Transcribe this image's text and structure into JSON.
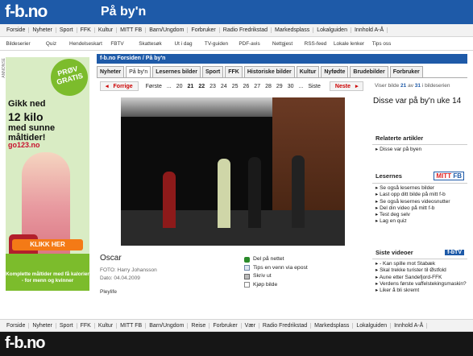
{
  "header": {
    "logo": "f-b.no",
    "page_title": "På by'n"
  },
  "nav_main": [
    "Forside",
    "Nyheter",
    "Sport",
    "FFK",
    "Kultur",
    "MITT FB",
    "Barn/Ungdom",
    "Forbruker",
    "Radio Fredrikstad",
    "Markedsplass",
    "Lokalguiden",
    "Innhold A-Å"
  ],
  "nav_sub": [
    "Bildeserier",
    "Quiz",
    "Hendelseskart",
    "FBTV",
    "Skattesøk",
    "Ut i dag",
    "TV-guiden",
    "PDF-avis",
    "Nettgjest",
    "RSS-feed",
    "Lokale lenker",
    "Tips oss"
  ],
  "ad": {
    "label": "ANNONSE",
    "badge": "PRØV GRATIS",
    "line1": "Gikk ned",
    "line2": "12 kilo",
    "line3": "med sunne måltider!",
    "brand": "go123.no",
    "cta": "KLIKK HER",
    "footer": "Komplette måltider med få kalorier - for menn og kvinner"
  },
  "breadcrumb": "f-b.no Forsiden / På by'n",
  "tabs": [
    "Nyheter",
    "På by'n",
    "Lesernes bilder",
    "Sport",
    "FFK",
    "Historiske bilder",
    "Kultur",
    "Nyfødte",
    "Brudebilder",
    "Forbruker"
  ],
  "pager": {
    "prev": "Forrige",
    "first": "Første",
    "pages": [
      "...",
      "20",
      "21",
      "22",
      "23",
      "24",
      "25",
      "26",
      "27",
      "28",
      "29",
      "30",
      "..."
    ],
    "current": "22",
    "last": "Siste",
    "next": "Neste"
  },
  "viewing": {
    "prefix": "Viser bilde",
    "current": "21",
    "sep": "av",
    "total": "31",
    "suffix": "i bildeserien"
  },
  "photo": {
    "caption": "Oscar",
    "photographer": "FOTO: Harry Johansson",
    "date": "Dato: 04.04.2009",
    "tag": "Pleylife"
  },
  "actions": [
    "Del på nettet",
    "Tips en venn via epost",
    "Skriv ut",
    "Kjøp bilde"
  ],
  "series_title": "Disse var på by'n uke 14",
  "related": {
    "heading": "Relaterte artikler",
    "items": [
      "Disse var på byen"
    ]
  },
  "readers": {
    "heading": "Lesernes",
    "badge_a": "MITT",
    "badge_b": "FB",
    "items": [
      "Se også lesernes bilder",
      "Last opp ditt bilde på mitt f-b",
      "Se også lesernes videosnutter",
      "Del din video på mitt f-b",
      "Test deg selv",
      "Lag en quiz"
    ]
  },
  "videos": {
    "heading": "Siste videoer",
    "badge": "f-bTV",
    "items": [
      "- Kan spille mot Stabæk",
      "Skal trekke turister til Østfold",
      "Aune etter Sandefjord-FFK",
      "Verdens første vaffelstekingsmaskin?",
      "Liker å bli skremt"
    ]
  },
  "nav_footer": [
    "Forside",
    "Nyheter",
    "Sport",
    "FFK",
    "Kultur",
    "MITT FB",
    "Barn/Ungdom",
    "Reise",
    "Forbruker",
    "Vær",
    "Radio Fredrikstad",
    "Markedsplass",
    "Lokalguiden",
    "Innhold A-Å"
  ],
  "footer_logo": "f-b.no"
}
